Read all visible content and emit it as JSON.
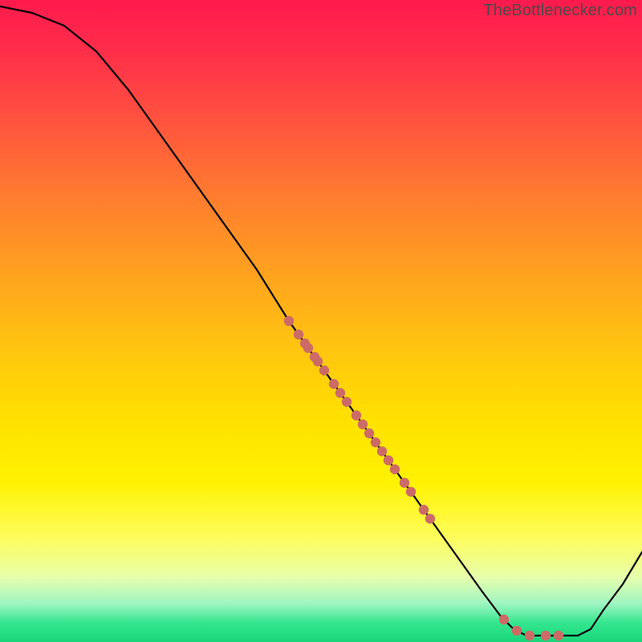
{
  "attribution": "TheBottlenecker.com",
  "chart_data": {
    "type": "line",
    "title": "",
    "xlabel": "",
    "ylabel": "",
    "xlim": [
      0,
      100
    ],
    "ylim": [
      0,
      100
    ],
    "curve": [
      {
        "x": 0,
        "y": 99
      },
      {
        "x": 5,
        "y": 98
      },
      {
        "x": 10,
        "y": 96
      },
      {
        "x": 15,
        "y": 92
      },
      {
        "x": 20,
        "y": 86
      },
      {
        "x": 25,
        "y": 79
      },
      {
        "x": 30,
        "y": 72
      },
      {
        "x": 35,
        "y": 65
      },
      {
        "x": 40,
        "y": 58
      },
      {
        "x": 45,
        "y": 50
      },
      {
        "x": 50,
        "y": 43
      },
      {
        "x": 55,
        "y": 36
      },
      {
        "x": 60,
        "y": 29
      },
      {
        "x": 65,
        "y": 22
      },
      {
        "x": 70,
        "y": 15
      },
      {
        "x": 75,
        "y": 8
      },
      {
        "x": 78,
        "y": 4
      },
      {
        "x": 80,
        "y": 2
      },
      {
        "x": 82,
        "y": 1
      },
      {
        "x": 85,
        "y": 1
      },
      {
        "x": 88,
        "y": 1
      },
      {
        "x": 90,
        "y": 1
      },
      {
        "x": 92,
        "y": 2
      },
      {
        "x": 94,
        "y": 5
      },
      {
        "x": 97,
        "y": 9
      },
      {
        "x": 100,
        "y": 14
      }
    ],
    "points_on_curve_x": [
      45,
      46.5,
      47.5,
      48,
      49,
      49.5,
      50.5,
      52,
      53,
      54,
      55.5,
      56.5,
      57.5,
      58.5,
      59.5,
      60.5,
      61.5,
      63,
      64,
      66,
      67,
      78.5,
      80.5,
      82.5,
      85,
      87
    ],
    "dot_radius": 6.2,
    "dot_color": "#cc6b66",
    "line_color": "#000000"
  }
}
